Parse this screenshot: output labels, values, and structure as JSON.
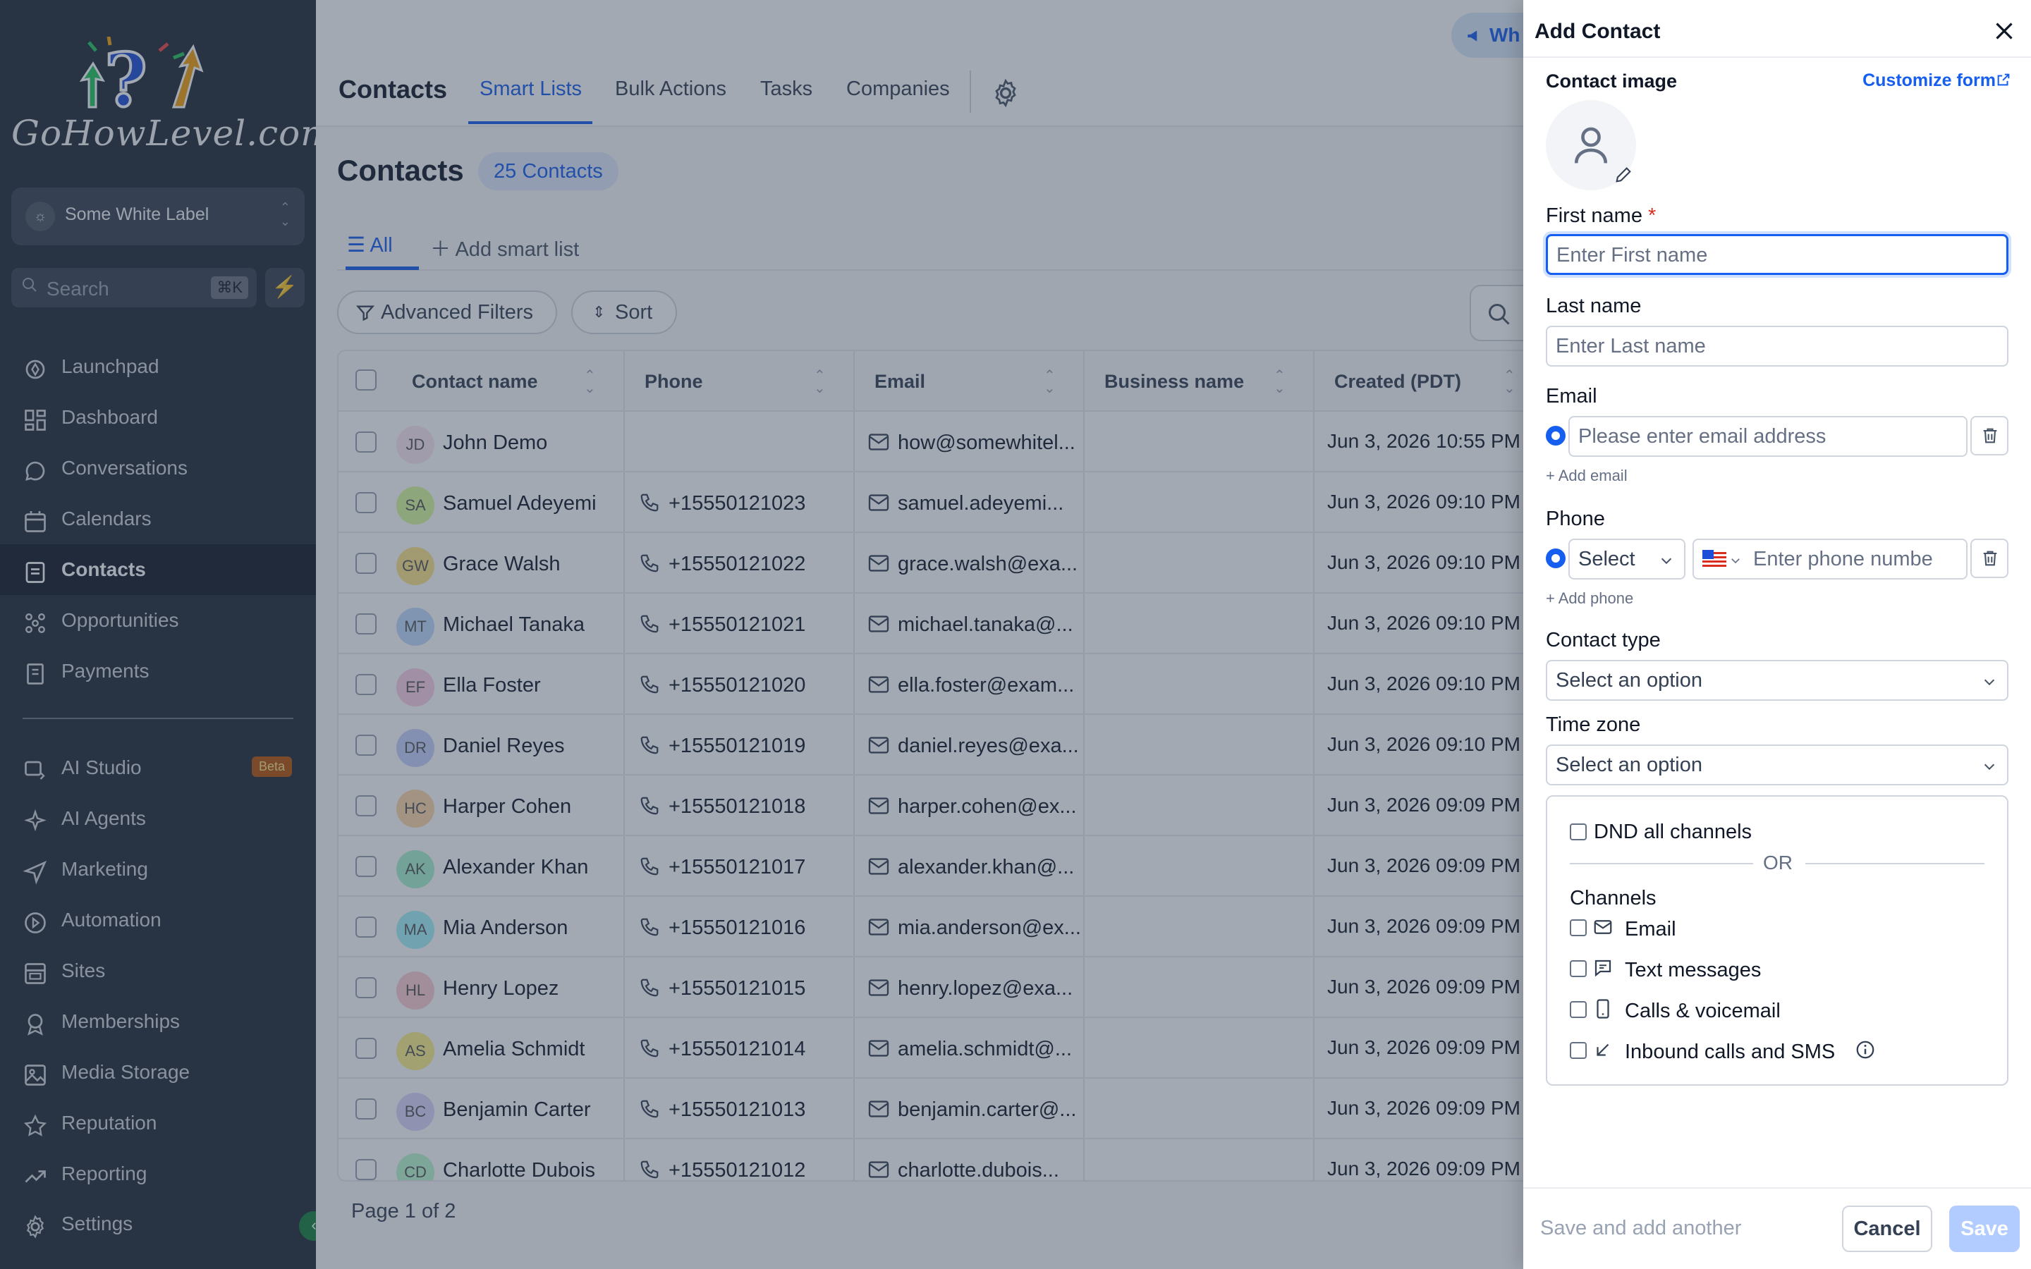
{
  "sidebar": {
    "logo_text": "GoHowLevel.com",
    "location": {
      "name": "Some White Label"
    },
    "search": {
      "placeholder": "Search",
      "shortcut": "⌘K"
    },
    "items": [
      {
        "label": "Launchpad",
        "icon": "rocket-icon"
      },
      {
        "label": "Dashboard",
        "icon": "dashboard-icon"
      },
      {
        "label": "Conversations",
        "icon": "chat-icon"
      },
      {
        "label": "Calendars",
        "icon": "calendar-icon"
      },
      {
        "label": "Contacts",
        "icon": "contacts-icon",
        "active": true
      },
      {
        "label": "Opportunities",
        "icon": "opportunities-icon"
      },
      {
        "label": "Payments",
        "icon": "payments-icon"
      },
      {
        "label": "AI Studio",
        "icon": "ai-studio-icon",
        "badge": "Beta"
      },
      {
        "label": "AI Agents",
        "icon": "sparkle-icon"
      },
      {
        "label": "Marketing",
        "icon": "send-icon"
      },
      {
        "label": "Automation",
        "icon": "automation-icon"
      },
      {
        "label": "Sites",
        "icon": "sites-icon"
      },
      {
        "label": "Memberships",
        "icon": "memberships-icon"
      },
      {
        "label": "Media Storage",
        "icon": "image-icon"
      },
      {
        "label": "Reputation",
        "icon": "star-icon"
      },
      {
        "label": "Reporting",
        "icon": "trend-icon"
      },
      {
        "label": "Settings",
        "icon": "gear-icon"
      }
    ]
  },
  "topbar": {
    "title": "Contacts",
    "tabs": [
      "Smart Lists",
      "Bulk Actions",
      "Tasks",
      "Companies"
    ],
    "whats_new": "Wh"
  },
  "main": {
    "title": "Contacts",
    "count_badge": "25 Contacts",
    "smart_tabs": {
      "all": "All",
      "add": "Add smart list"
    },
    "advanced_filters": "Advanced Filters",
    "sort": "Sort",
    "pager": "Page 1 of 2"
  },
  "table": {
    "columns": [
      "Contact name",
      "Phone",
      "Email",
      "Business name",
      "Created (PDT)"
    ],
    "rows": [
      {
        "initials": "JD",
        "name": "John Demo",
        "phone": "",
        "email": "how@somewhitel...",
        "created": "Jun 3, 2026 10:55 PM",
        "color": "#fce7f3"
      },
      {
        "initials": "SA",
        "name": "Samuel Adeyemi",
        "phone": "+15550121023",
        "email": "samuel.adeyemi...",
        "created": "Jun 3, 2026 09:10 PM",
        "color": "#d9f99d"
      },
      {
        "initials": "GW",
        "name": "Grace Walsh",
        "phone": "+15550121022",
        "email": "grace.walsh@exa...",
        "created": "Jun 3, 2026 09:10 PM",
        "color": "#fde68a"
      },
      {
        "initials": "MT",
        "name": "Michael Tanaka",
        "phone": "+15550121021",
        "email": "michael.tanaka@...",
        "created": "Jun 3, 2026 09:10 PM",
        "color": "#bfdbfe"
      },
      {
        "initials": "EF",
        "name": "Ella Foster",
        "phone": "+15550121020",
        "email": "ella.foster@exam...",
        "created": "Jun 3, 2026 09:10 PM",
        "color": "#fbcfe8"
      },
      {
        "initials": "DR",
        "name": "Daniel Reyes",
        "phone": "+15550121019",
        "email": "daniel.reyes@exa...",
        "created": "Jun 3, 2026 09:10 PM",
        "color": "#c7d2fe"
      },
      {
        "initials": "HC",
        "name": "Harper Cohen",
        "phone": "+15550121018",
        "email": "harper.cohen@ex...",
        "created": "Jun 3, 2026 09:09 PM",
        "color": "#fed7aa"
      },
      {
        "initials": "AK",
        "name": "Alexander Khan",
        "phone": "+15550121017",
        "email": "alexander.khan@...",
        "created": "Jun 3, 2026 09:09 PM",
        "color": "#a7f3d0"
      },
      {
        "initials": "MA",
        "name": "Mia Anderson",
        "phone": "+15550121016",
        "email": "mia.anderson@ex...",
        "created": "Jun 3, 2026 09:09 PM",
        "color": "#a5f3fc"
      },
      {
        "initials": "HL",
        "name": "Henry Lopez",
        "phone": "+15550121015",
        "email": "henry.lopez@exa...",
        "created": "Jun 3, 2026 09:09 PM",
        "color": "#fecdd3"
      },
      {
        "initials": "AS",
        "name": "Amelia Schmidt",
        "phone": "+15550121014",
        "email": "amelia.schmidt@...",
        "created": "Jun 3, 2026 09:09 PM",
        "color": "#fef08a"
      },
      {
        "initials": "BC",
        "name": "Benjamin Carter",
        "phone": "+15550121013",
        "email": "benjamin.carter@...",
        "created": "Jun 3, 2026 09:09 PM",
        "color": "#ddd6fe"
      },
      {
        "initials": "CD",
        "name": "Charlotte Dubois",
        "phone": "+15550121012",
        "email": "charlotte.dubois...",
        "created": "Jun 3, 2026 09:09 PM",
        "color": "#bbf7d0"
      }
    ]
  },
  "panel": {
    "title": "Add Contact",
    "customize": "Customize form",
    "contact_image": "Contact image",
    "first_name": {
      "label": "First name",
      "required": "*",
      "placeholder": "Enter First name"
    },
    "last_name": {
      "label": "Last name",
      "placeholder": "Enter Last name"
    },
    "email": {
      "label": "Email",
      "placeholder": "Please enter email address",
      "add": "+ Add email"
    },
    "phone": {
      "label": "Phone",
      "type_placeholder": "Select",
      "placeholder": "Enter phone numbe",
      "add": "+ Add phone"
    },
    "contact_type": {
      "label": "Contact type",
      "placeholder": "Select an option"
    },
    "time_zone": {
      "label": "Time zone",
      "placeholder": "Select an option"
    },
    "dnd": {
      "all": "DND all channels",
      "or": "OR",
      "channels_label": "Channels",
      "channels": [
        "Email",
        "Text messages",
        "Calls & voicemail",
        "Inbound calls and SMS"
      ]
    },
    "footer": {
      "save_another": "Save and add another",
      "cancel": "Cancel",
      "save": "Save"
    }
  },
  "colors": {
    "accent": "#155eef",
    "sidebar_bg": "#1f2937",
    "active_bg": "#111827"
  }
}
